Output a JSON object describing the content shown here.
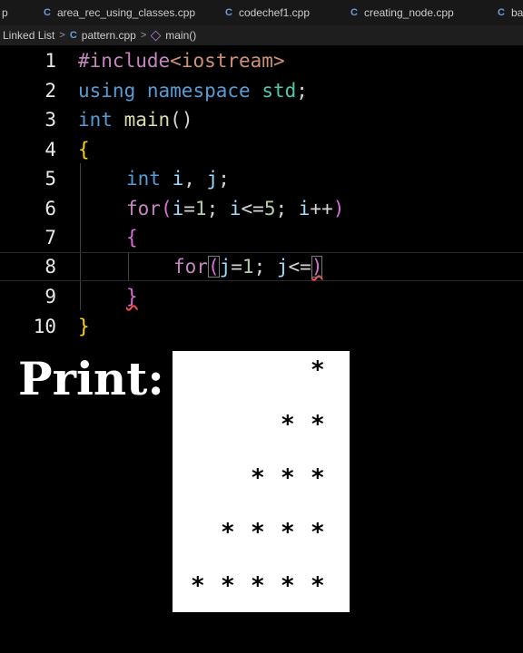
{
  "tabs": [
    {
      "label": "p",
      "icon": ""
    },
    {
      "label": "area_rec_using_classes.cpp",
      "icon": "C"
    },
    {
      "label": "codechef1.cpp",
      "icon": "C"
    },
    {
      "label": "creating_node.cpp",
      "icon": "C"
    },
    {
      "label": "ba",
      "icon": "C"
    }
  ],
  "breadcrumb": {
    "folder": "Linked List",
    "file": "pattern.cpp",
    "file_icon": "C",
    "symbol": "main()",
    "separator": ">"
  },
  "editor": {
    "line_numbers": [
      "1",
      "2",
      "3",
      "4",
      "5",
      "6",
      "7",
      "8",
      "9",
      "10"
    ],
    "code": {
      "l1_directive": "#include",
      "l1_header": "<iostream>",
      "l2_using": "using",
      "l2_namespace": "namespace",
      "l2_std": "std",
      "l2_semi": ";",
      "l3_int": "int",
      "l3_main": "main",
      "l3_parens": "()",
      "l4_open": "{",
      "l5_int": "int",
      "l5_i": "i",
      "l5_comma": ", ",
      "l5_j": "j",
      "l5_semi": ";",
      "l6_for": "for",
      "l6_open": "(",
      "l6_i1": "i",
      "l6_eq": "=",
      "l6_one": "1",
      "l6_semi1": "; ",
      "l6_i2": "i",
      "l6_le": "<=",
      "l6_five": "5",
      "l6_semi2": "; ",
      "l6_i3": "i",
      "l6_inc": "++",
      "l6_close": ")",
      "l7_open": "{",
      "l8_for": "for",
      "l8_open": "(",
      "l8_j1": "j",
      "l8_eq": "=",
      "l8_one": "1",
      "l8_semi": "; ",
      "l8_j2": "j",
      "l8_le": "<=",
      "l8_close": ")",
      "l9_close": "}",
      "l10_close": "}"
    }
  },
  "overlay": {
    "print_label": "Print:",
    "pattern_rows": [
      1,
      2,
      3,
      4,
      5
    ],
    "star_char": "*"
  },
  "colors": {
    "keyword": "#569cd6",
    "preprocessor": "#c586c0",
    "type": "#4ec9b0",
    "function": "#dcdcaa",
    "number": "#b5cea8",
    "string": "#ce9178",
    "variable": "#9cdcfe",
    "brace_level1": "#ffd700",
    "brace_level2": "#da70d6"
  }
}
